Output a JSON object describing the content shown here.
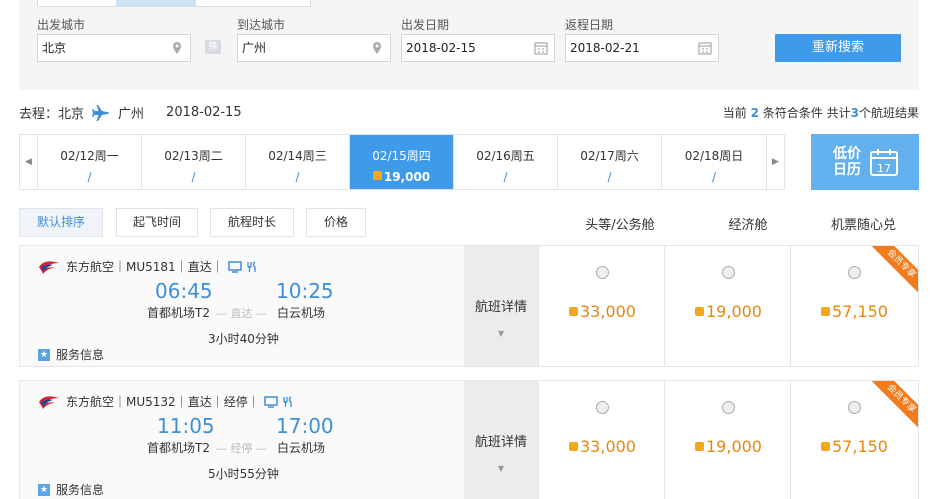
{
  "search": {
    "depart_city_label": "出发城市",
    "depart_city": "北京",
    "arrive_city_label": "到达城市",
    "arrive_city": "广州",
    "depart_date_label": "出发日期",
    "depart_date": "2018-02-15",
    "return_date_label": "返程日期",
    "return_date": "2018-02-21",
    "swap_label": "换",
    "research_label": "重新搜索"
  },
  "route": {
    "prefix": "去程：",
    "from": "北京",
    "to": "广州",
    "date": "2018-02-15"
  },
  "summary": {
    "t1": "当前 ",
    "current": "2",
    "t2": " 条符合条件 共计",
    "total": "3",
    "t3": "个航班结果"
  },
  "dates": [
    {
      "date": "02/12周一",
      "price": "/"
    },
    {
      "date": "02/13周二",
      "price": "/"
    },
    {
      "date": "02/14周三",
      "price": "/"
    },
    {
      "date": "02/15周四",
      "price": "19,000",
      "active": true
    },
    {
      "date": "02/16周五",
      "price": "/"
    },
    {
      "date": "02/17周六",
      "price": "/"
    },
    {
      "date": "02/18周日",
      "price": "/"
    }
  ],
  "calendar": {
    "label": "低价日历",
    "day": "17"
  },
  "sort": {
    "default": "默认排序",
    "depart_time": "起飞时间",
    "duration": "航程时长",
    "price": "价格"
  },
  "columns": {
    "first": "头等/公务舱",
    "economy": "经济舱",
    "flex": "机票随心兑"
  },
  "flights": [
    {
      "airline": "东方航空",
      "info": "｜MU5181｜直达｜",
      "dep_time": "06:45",
      "arr_time": "10:25",
      "dep_airport": "首都机场T2",
      "arr_airport": "白云机场",
      "mid": "— 直达 —",
      "duration": "3小时40分钟",
      "service": "服务信息",
      "detail": "航班详情",
      "prices": [
        "33,000",
        "19,000",
        "57,150"
      ],
      "badge": "会员专享"
    },
    {
      "airline": "东方航空",
      "info": "｜MU5132｜直达｜经停｜",
      "dep_time": "11:05",
      "arr_time": "17:00",
      "dep_airport": "首都机场T2",
      "arr_airport": "白云机场",
      "mid": "— 经停 —",
      "duration": "5小时55分钟",
      "service": "服务信息",
      "detail": "航班详情",
      "prices": [
        "33,000",
        "19,000",
        "57,150"
      ],
      "badge": "会员专享"
    }
  ],
  "colors": {
    "accent": "#3e9bea",
    "price": "#e8870a",
    "link": "#3e8ed8"
  }
}
